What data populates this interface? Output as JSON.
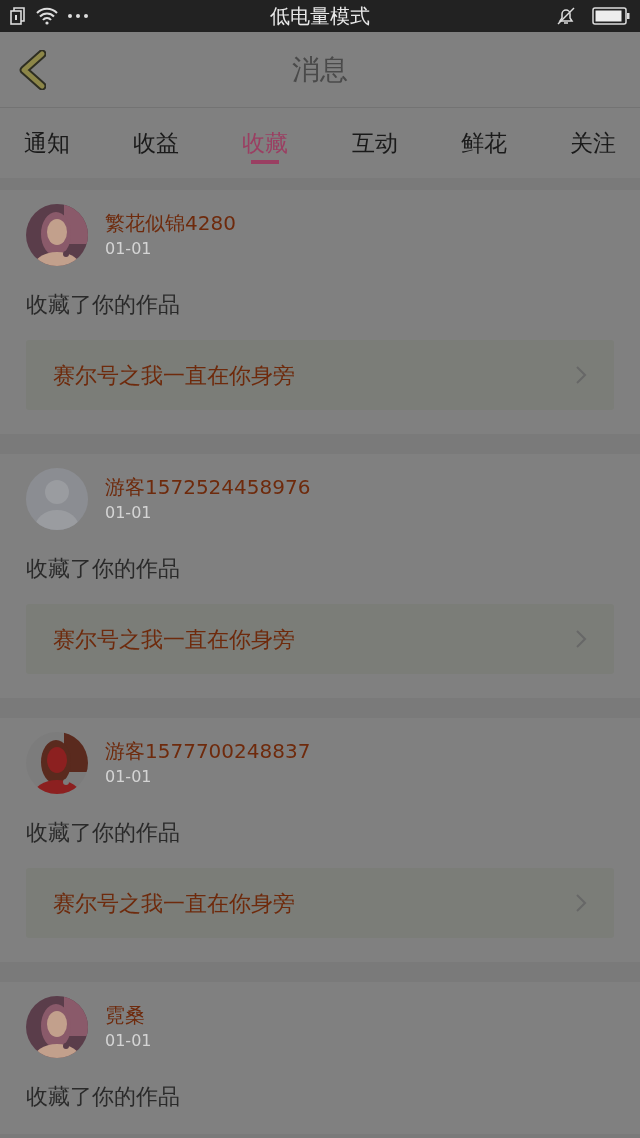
{
  "status_bar": {
    "title": "低电量模式"
  },
  "header": {
    "title": "消息"
  },
  "tabs": [
    {
      "label": "通知",
      "selected": false
    },
    {
      "label": "收益",
      "selected": false
    },
    {
      "label": "收藏",
      "selected": true
    },
    {
      "label": "互动",
      "selected": false
    },
    {
      "label": "鲜花",
      "selected": false
    },
    {
      "label": "关注",
      "selected": false
    }
  ],
  "messages": [
    {
      "name": "繁花似锦4280",
      "date": "01-01",
      "text": "收藏了你的作品",
      "link": "赛尔号之我一直在你身旁"
    },
    {
      "avatar": {
        "kind": "default"
      },
      "name": "游客1572524458976",
      "date": "01-01",
      "text": "收藏了你的作品",
      "link": "赛尔号之我一直在你身旁"
    },
    {
      "name": "游客1577700248837",
      "date": "01-01",
      "text": "收藏了你的作品",
      "link": "赛尔号之我一直在你身旁"
    },
    {
      "name": "霓桑",
      "date": "01-01",
      "text": "收藏了你的作品"
    }
  ]
}
